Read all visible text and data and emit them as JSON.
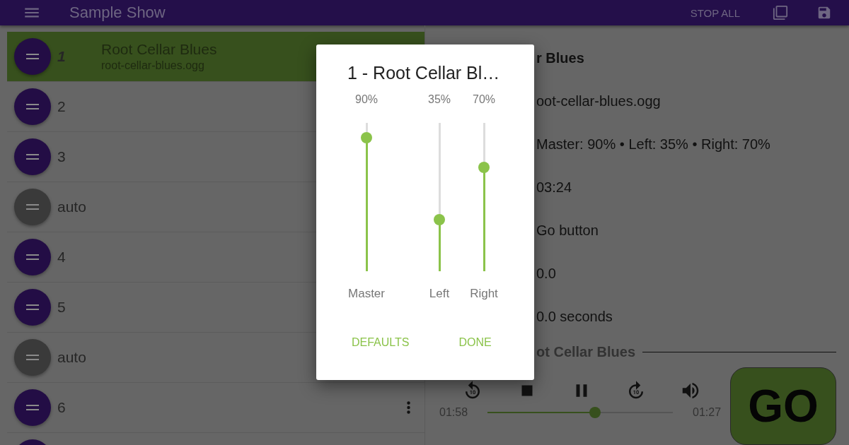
{
  "app_bar": {
    "title": "Sample Show",
    "action": "STOP ALL"
  },
  "cues": [
    {
      "kind": "cue",
      "number": "1",
      "title": "Root Cellar Blues",
      "file": "root-cellar-blues.ogg",
      "selected": true,
      "menu": false
    },
    {
      "kind": "cue",
      "number": "2",
      "selected": false,
      "menu": false
    },
    {
      "kind": "cue",
      "number": "3",
      "selected": false,
      "menu": false
    },
    {
      "kind": "auto",
      "number": "auto",
      "selected": false,
      "menu": false
    },
    {
      "kind": "cue",
      "number": "4",
      "selected": false,
      "menu": false
    },
    {
      "kind": "cue",
      "number": "5",
      "selected": false,
      "menu": false
    },
    {
      "kind": "auto",
      "number": "auto",
      "selected": false,
      "menu": false
    },
    {
      "kind": "cue",
      "number": "6",
      "selected": false,
      "menu": true
    },
    {
      "kind": "cue",
      "selected": false,
      "menu": false
    }
  ],
  "details": [
    {
      "kind": "heading",
      "text": "r Blues"
    },
    {
      "kind": "line",
      "text": "oot-cellar-blues.ogg"
    },
    {
      "kind": "line",
      "text": "Master: 90% • Left: 35% • Right: 70%"
    },
    {
      "kind": "line",
      "text": "03:24"
    },
    {
      "kind": "line",
      "text": "Go button"
    },
    {
      "kind": "line",
      "text": "0.0"
    },
    {
      "kind": "line",
      "text": "0.0 seconds"
    }
  ],
  "now_playing": {
    "title": "ot Cellar Blues",
    "elapsed": "01:58",
    "remaining": "01:27",
    "level": 0.58,
    "go_label": "GO"
  },
  "dialog": {
    "title": "1 - Root Cellar Bl…",
    "channels": [
      {
        "name": "Master",
        "reading": "90%",
        "level": 0.9
      },
      {
        "name": "Left",
        "reading": "35%",
        "level": 0.35
      },
      {
        "name": "Right",
        "reading": "70%",
        "level": 0.7
      }
    ],
    "buttons": [
      "DEFAULTS",
      "DONE"
    ]
  }
}
